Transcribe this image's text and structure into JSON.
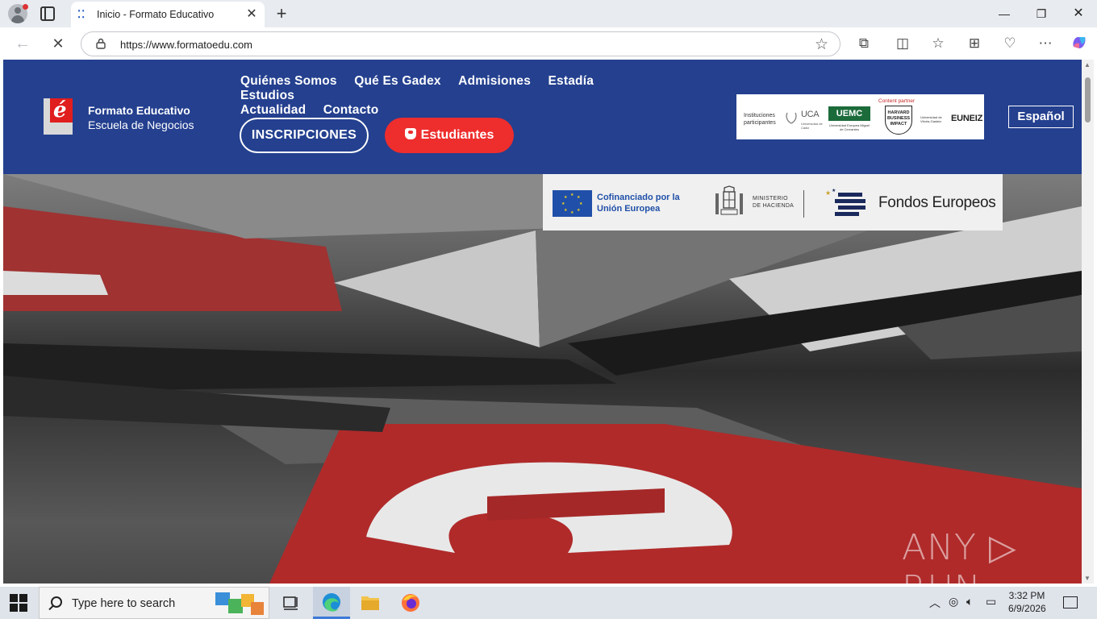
{
  "browser": {
    "tab_title": "Inicio - Formato Educativo",
    "url": "https://www.formatoedu.com",
    "icons": [
      "profile-icon",
      "tab-actions-icon",
      "close-icon",
      "new-tab-icon",
      "back-icon",
      "stop-icon",
      "lock-icon",
      "star-icon",
      "extensions-icon",
      "split-screen-icon",
      "favorites-icon",
      "collections-icon",
      "browser-essentials-icon",
      "more-icon",
      "copilot-icon"
    ]
  },
  "site": {
    "logo_name": "Formato Educativo",
    "logo_tagline": "Escuela de Negocios",
    "nav": [
      "Quiénes Somos",
      "Qué Es Gadex",
      "Admisiones",
      "Estadía",
      "Estudios",
      "Actualidad",
      "Contacto"
    ],
    "btn_inscripciones": "INSCRIPCIONES",
    "btn_estudiantes": "Estudiantes",
    "language": "Español",
    "partners": {
      "label": "Instituciones participantes",
      "uca": "UCA",
      "uca_sub": "Universidad de Cádiz",
      "uemc": "UEMC",
      "uemc_sub": "Universidad Europea Miguel de Cervantes",
      "hbs_label": "Content partner",
      "hbs": "HARVARD BUSINESS IMPACT",
      "euneiz_sub": "Universidad de Vitoria-Gasteiz",
      "euneiz": "EUNEIZ"
    },
    "eu_banner": {
      "cofinanciado": "Cofinanciado por la Unión Europea",
      "ministerio": "MINISTERIO DE HACIENDA",
      "fondos": "Fondos Europeos"
    },
    "watermark": "ANY ▷ RUN"
  },
  "taskbar": {
    "search_placeholder": "Type here to search",
    "time": "3:32 PM",
    "date": "6/9/2026"
  },
  "colors": {
    "header_blue": "#24408f",
    "accent_red": "#ee2d2d"
  }
}
